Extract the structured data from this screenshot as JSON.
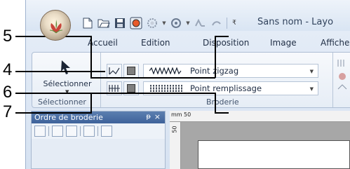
{
  "app": {
    "title": "Sans nom - Layo"
  },
  "tabs": [
    "Accueil",
    "Edition",
    "Disposition",
    "Image",
    "Affiche"
  ],
  "ribbon": {
    "select_group": {
      "button_label": "Sélectionner",
      "group_label": "Sélectionner"
    },
    "broderie_group": {
      "group_label": "Broderie",
      "row1": {
        "stitch_name": "Point zigzag"
      },
      "row2": {
        "stitch_name": "Point remplissage"
      }
    }
  },
  "panel": {
    "title": "Ordre de broderie",
    "pin_glyph": "ᵽ",
    "close_glyph": "×"
  },
  "rulers": {
    "unit": "mm",
    "top_mark": "50",
    "left_mark": "50"
  },
  "callouts": [
    "5",
    "4",
    "6",
    "7"
  ],
  "colors": {
    "accent": "#3e629a",
    "swatch": "#7f7f7f"
  }
}
